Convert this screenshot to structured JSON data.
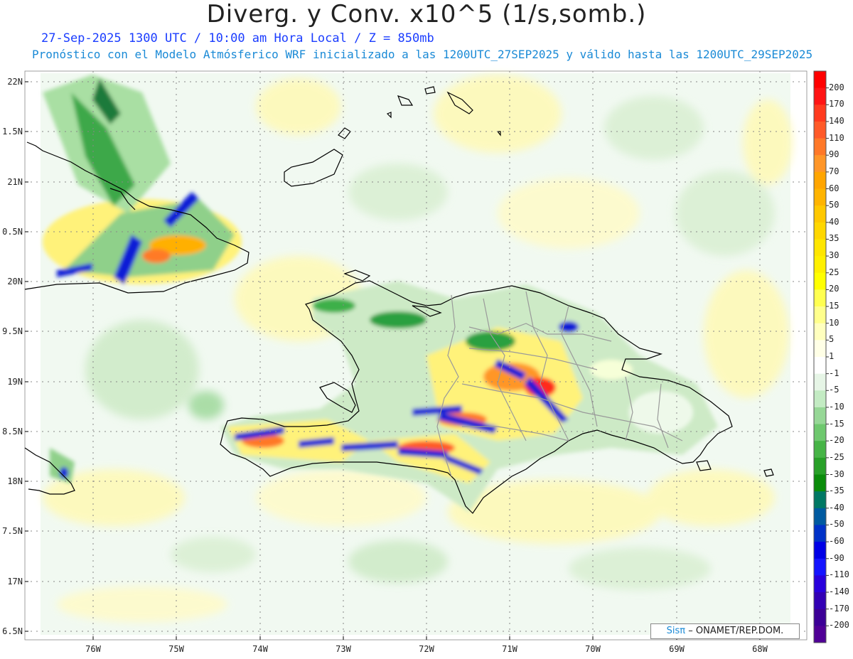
{
  "header": {
    "title": "Diverg. y Conv. x10^5 (1/s,somb.)",
    "subtitle": "27-Sep-2025 1300 UTC / 10:00 am Hora Local / Z = 850mb",
    "forecast_note": "Pronóstico con el Modelo Atmósferico WRF inicializado a las 1200UTC_27SEP2025 y válido hasta las  1200UTC_29SEP2025"
  },
  "map": {
    "lat_labels": [
      "22N",
      "1.5N",
      "21N",
      "0.5N",
      "20N",
      "9.5N",
      "19N",
      "8.5N",
      "18N",
      "7.5N",
      "17N",
      "6.5N"
    ],
    "lon_labels": [
      "76W",
      "75W",
      "74W",
      "73W",
      "72W",
      "71W",
      "70W",
      "69W",
      "68W"
    ]
  },
  "colorbar": {
    "labels": [
      "200",
      "170",
      "140",
      "110",
      "90",
      "70",
      "60",
      "50",
      "40",
      "35",
      "30",
      "25",
      "20",
      "15",
      "10",
      "5",
      "1",
      "-1",
      "-5",
      "-10",
      "-15",
      "-20",
      "-25",
      "-30",
      "-35",
      "-40",
      "-50",
      "-60",
      "-90",
      "-110",
      "-140",
      "-170",
      "-200"
    ],
    "colors": [
      "#ff0000",
      "#ff1414",
      "#ff3a1e",
      "#ff5a28",
      "#ff7828",
      "#ff9628",
      "#ffa500",
      "#ffb400",
      "#ffc800",
      "#ffd700",
      "#ffe600",
      "#fff000",
      "#ffff00",
      "#ffff50",
      "#ffff8c",
      "#ffffbe",
      "#ffffe6",
      "#ffffff",
      "#e6f5e6",
      "#c3ebc3",
      "#96d796",
      "#6ec86e",
      "#46b446",
      "#28a028",
      "#0a8c0a",
      "#007864",
      "#005aa0",
      "#0032c8",
      "#0000e6",
      "#1414ff",
      "#2800dc",
      "#3200b4",
      "#3c0096",
      "#500096"
    ]
  },
  "footer": {
    "credit_sis": "Sisπ",
    "credit_text": "– ONAMET/REP.DOM."
  }
}
